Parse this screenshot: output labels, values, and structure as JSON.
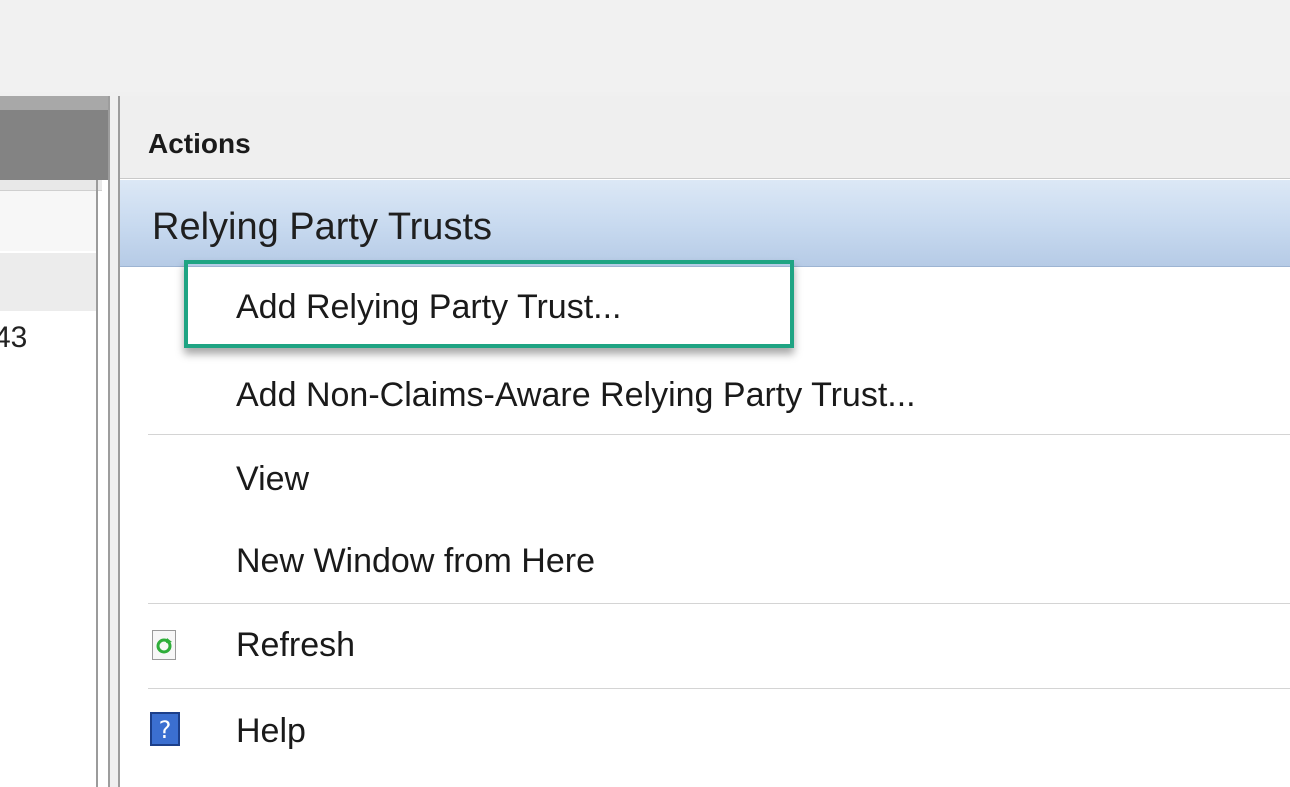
{
  "left_pane": {
    "cell_value": "43"
  },
  "actions": {
    "title": "Actions",
    "section_title": "Relying Party Trusts",
    "items": [
      {
        "label": "Add Relying Party Trust...",
        "icon": "",
        "highlighted": true
      },
      {
        "label": "Add Non-Claims-Aware Relying Party Trust...",
        "icon": ""
      },
      {
        "label": "View",
        "icon": ""
      },
      {
        "label": "New Window from Here",
        "icon": ""
      },
      {
        "label": "Refresh",
        "icon": "refresh-icon"
      },
      {
        "label": "Help",
        "icon": "help-icon"
      }
    ]
  },
  "colors": {
    "highlight_border": "#1fa483",
    "section_header": "#c7d9ef"
  }
}
